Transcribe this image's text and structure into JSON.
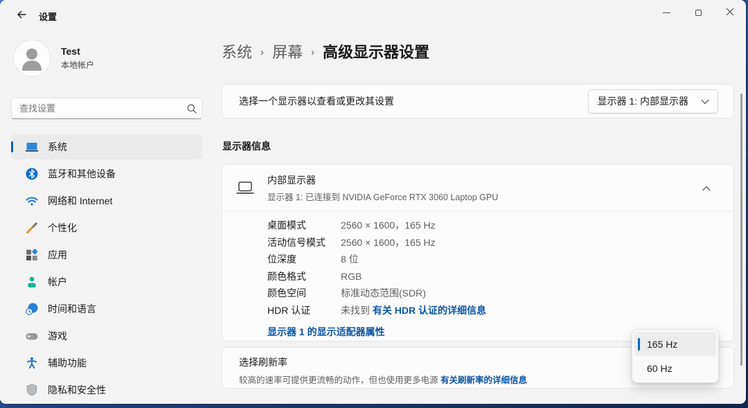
{
  "colors": {
    "accent": "#0067c0",
    "link": "#0b57a4"
  },
  "titlebar": {
    "title": "设置"
  },
  "sidebar": {
    "user": {
      "name": "Test",
      "type": "本地帐户"
    },
    "search": {
      "placeholder": "查找设置"
    },
    "items": [
      {
        "label": "系统",
        "icon": "system-icon",
        "selected": true
      },
      {
        "label": "蓝牙和其他设备",
        "icon": "bluetooth-icon",
        "selected": false
      },
      {
        "label": "网络和 Internet",
        "icon": "network-icon",
        "selected": false
      },
      {
        "label": "个性化",
        "icon": "personalization-icon",
        "selected": false
      },
      {
        "label": "应用",
        "icon": "apps-icon",
        "selected": false
      },
      {
        "label": "帐户",
        "icon": "accounts-icon",
        "selected": false
      },
      {
        "label": "时间和语言",
        "icon": "time-language-icon",
        "selected": false
      },
      {
        "label": "游戏",
        "icon": "gaming-icon",
        "selected": false
      },
      {
        "label": "辅助功能",
        "icon": "accessibility-icon",
        "selected": false
      },
      {
        "label": "隐私和安全性",
        "icon": "privacy-icon",
        "selected": false
      }
    ]
  },
  "main": {
    "breadcrumb": {
      "items": [
        "系统",
        "屏幕",
        "高级显示器设置"
      ],
      "separator": "›"
    },
    "display_select_card": {
      "label": "选择一个显示器以查看或更改其设置",
      "dropdown_value": "显示器 1: 内部显示器"
    },
    "display_info": {
      "section_title": "显示器信息",
      "card": {
        "title": "内部显示器",
        "subtitle": "显示器 1: 已连接到 NVIDIA GeForce RTX 3060 Laptop GPU",
        "details": [
          {
            "label": "桌面模式",
            "value": "2560 × 1600，165 Hz"
          },
          {
            "label": "活动信号模式",
            "value": "2560 × 1600，165 Hz"
          },
          {
            "label": "位深度",
            "value": "8 位"
          },
          {
            "label": "颜色格式",
            "value": "RGB"
          },
          {
            "label": "颜色空间",
            "value": "标准动态范围(SDR)"
          },
          {
            "label": "HDR 认证",
            "value": "未找到",
            "link": "有关 HDR 认证的详细信息"
          }
        ],
        "adapter_link": "显示器 1 的显示适配器属性"
      }
    },
    "refresh_rate_card": {
      "title": "选择刷新率",
      "description": "较高的速率可提供更流畅的动作，但也使用更多电源",
      "link": "有关刷新率的详细信息"
    },
    "refresh_rate_flyout": {
      "options": [
        {
          "label": "165 Hz",
          "selected": true
        },
        {
          "label": "60 Hz",
          "selected": false
        }
      ]
    }
  }
}
